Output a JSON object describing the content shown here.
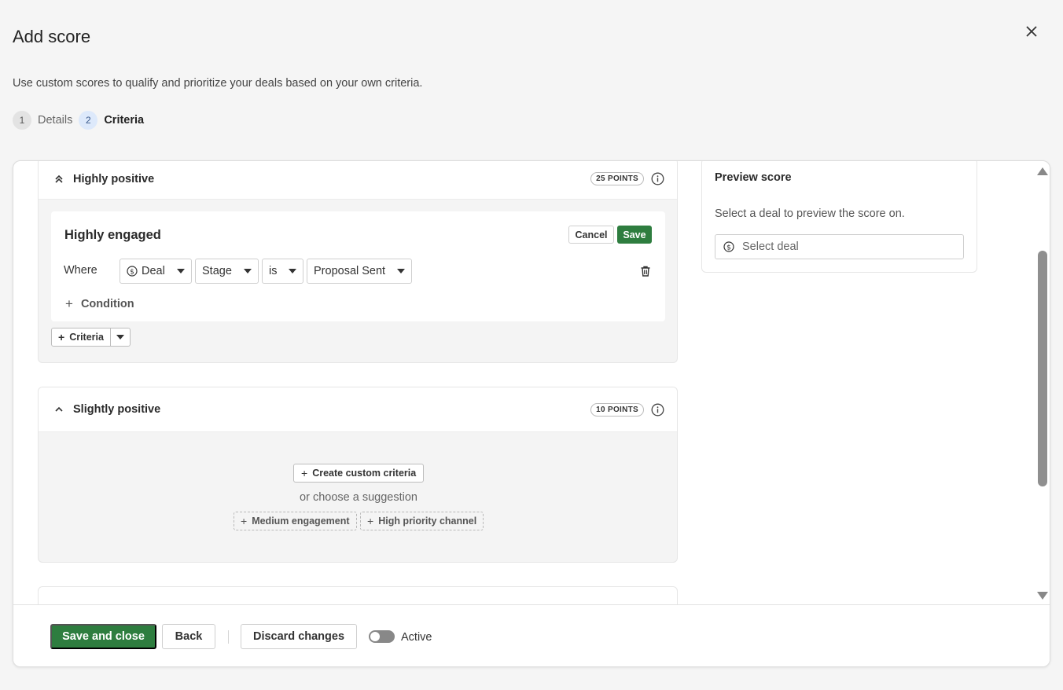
{
  "dialog": {
    "title": "Add score",
    "subtitle": "Use custom scores to qualify and prioritize your deals based on your own criteria."
  },
  "steps": [
    {
      "number": "1",
      "label": "Details"
    },
    {
      "number": "2",
      "label": "Criteria"
    }
  ],
  "sections": {
    "highly_positive": {
      "title": "Highly positive",
      "points": "25 POINTS",
      "criteria": {
        "name": "Highly engaged",
        "cancel_label": "Cancel",
        "save_label": "Save",
        "where_label": "Where",
        "object": "Deal",
        "field": "Stage",
        "operator": "is",
        "value": "Proposal Sent",
        "add_condition_label": "Condition"
      },
      "add_criteria_label": "Criteria"
    },
    "slightly_positive": {
      "title": "Slightly positive",
      "points": "10 POINTS",
      "create_label": "Create custom criteria",
      "or_label": "or choose a suggestion",
      "suggestions": [
        "Medium engagement",
        "High priority channel"
      ]
    }
  },
  "preview": {
    "title": "Preview score",
    "description": "Select a deal to preview the score on.",
    "placeholder": "Select deal"
  },
  "footer": {
    "save_close_label": "Save and close",
    "back_label": "Back",
    "discard_label": "Discard changes",
    "active_label": "Active",
    "active_on": false
  },
  "colors": {
    "primary": "#2e7d3f",
    "background": "#f5f5f5"
  }
}
